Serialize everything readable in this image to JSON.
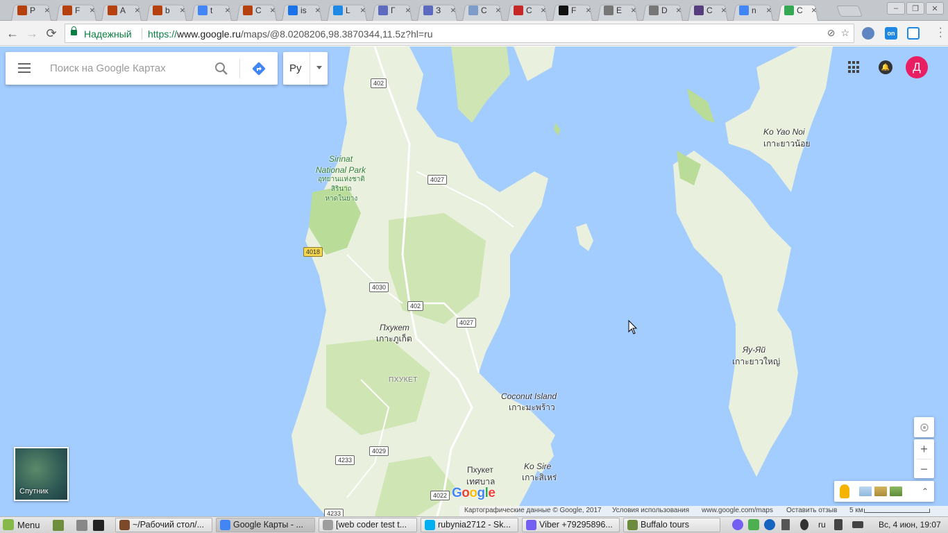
{
  "browser": {
    "tabs": [
      {
        "title": "P",
        "icon": "brick-icon",
        "color": "#b5410f"
      },
      {
        "title": "F",
        "icon": "brick-icon",
        "color": "#b5410f"
      },
      {
        "title": "A",
        "icon": "brick-icon",
        "color": "#b5410f"
      },
      {
        "title": "b",
        "icon": "brick-icon",
        "color": "#b5410f"
      },
      {
        "title": "t",
        "icon": "google-icon",
        "color": "#4285f4"
      },
      {
        "title": "C",
        "icon": "brick-icon",
        "color": "#b5410f"
      },
      {
        "title": "is",
        "icon": "image-icon",
        "color": "#1a73e8"
      },
      {
        "title": "L",
        "icon": "line-icon",
        "color": "#1e88e5"
      },
      {
        "title": "Г",
        "icon": "doc-icon",
        "color": "#5c6bc0"
      },
      {
        "title": "З",
        "icon": "doc-icon",
        "color": "#5c6bc0"
      },
      {
        "title": "C",
        "icon": "cloud-icon",
        "color": "#7e9cc9"
      },
      {
        "title": "C",
        "icon": "figure-icon",
        "color": "#c62828"
      },
      {
        "title": "F",
        "icon": "flag-icon",
        "color": "#111111"
      },
      {
        "title": "E",
        "icon": "page-icon",
        "color": "#777777"
      },
      {
        "title": "D",
        "icon": "page-icon",
        "color": "#777777"
      },
      {
        "title": "C",
        "icon": "bootstrap-icon",
        "color": "#563d7c"
      },
      {
        "title": "n",
        "icon": "google-icon",
        "color": "#4285f4"
      },
      {
        "title": "C",
        "icon": "maps-icon",
        "color": "#34a853",
        "active": true
      }
    ],
    "nav": {
      "back": "←",
      "forward": "→",
      "reload": "⟳"
    },
    "secure_label": "Надежный",
    "url": {
      "proto": "https://",
      "host": "www.google.ru",
      "path": "/maps/@8.0208206,98.3870344,11.5z?hl=ru"
    },
    "window_buttons": [
      "–",
      "❐",
      "✕"
    ]
  },
  "maps": {
    "search_placeholder": "Поиск на Google Картах",
    "language": "Ру",
    "avatar_letter": "Д",
    "satellite_label": "Спутник",
    "zoom_in": "+",
    "zoom_out": "−",
    "expand": "⌃",
    "google_logo": [
      "G",
      "o",
      "o",
      "g",
      "l",
      "e"
    ],
    "google_colors": [
      "#4285f4",
      "#ea4335",
      "#fbbc05",
      "#4285f4",
      "#34a853",
      "#ea4335"
    ],
    "labels": {
      "sirinat": "Sirinat\nNational Park",
      "sirinat_thai": "อุทยานแห่งชาติ\nสิรินาถ\nหาดในยาง",
      "phuket": "Пхукет",
      "phuket_thai": "เกาะภูเก็ต",
      "phuket_region": "ПХУКЕТ",
      "phuket_town": "Пхукет",
      "phuket_town_thai": "เทศบาล",
      "coconut": "Coconut Island",
      "coconut_thai": "เกาะมะพร้าว",
      "kosire": "Ko Sire",
      "kosire_thai": "เกาะสิเหร่",
      "koyaonoi": "Ko Yao Noi",
      "koyaonoi_thai": "เกาะยาวน้อย",
      "yauyai": "Яу-Яй",
      "yauyai_thai": "เกาะยาวใหญ่"
    },
    "roads": {
      "r402a": "402",
      "r4027a": "4027",
      "r4018": "4018",
      "r4030": "4030",
      "r402b": "402",
      "r4027b": "4027",
      "r4029": "4029",
      "r4233": "4233",
      "r4022": "4022",
      "r4233b": "4233"
    },
    "footer": {
      "map_data": "Картографические данные © Google, 2017",
      "terms": "Условия использования",
      "site": "www.google.com/maps",
      "feedback": "Оставить отзыв",
      "scale": "5 км"
    },
    "colors": {
      "water": "#a3ccff",
      "land": "#e9f0dd",
      "park": "#b9dc98",
      "forest": "#cfe5b4"
    }
  },
  "taskbar": {
    "menu_label": "Menu",
    "tasks": [
      {
        "label": "~/Рабочий стол/...",
        "color": "#7a4a2a"
      },
      {
        "label": "Google Карты - ...",
        "color": "#4285f4",
        "active": true
      },
      {
        "label": "[web coder test t...",
        "color": "#9e9e9e"
      },
      {
        "label": "rubynia2712 - Sk...",
        "color": "#00aff0"
      },
      {
        "label": "Viber +79295896...",
        "color": "#7360f2"
      },
      {
        "label": "Buffalo tours",
        "color": "#6d8b3f"
      }
    ],
    "keyboard_layout": "ru",
    "clock": "Вс, 4 июн, 19:07"
  }
}
